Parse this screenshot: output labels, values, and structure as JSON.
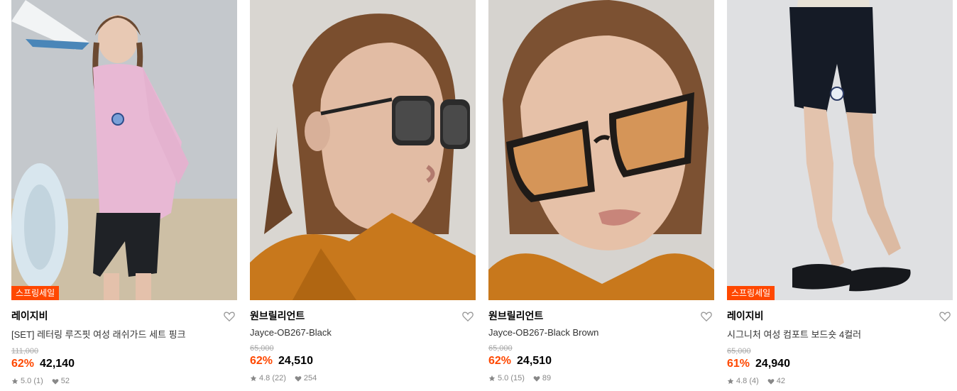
{
  "products": [
    {
      "badge": "스프링세일",
      "brand": "레이지비",
      "title": "[SET] 레터링 루즈핏 여성 래쉬가드 세트 핑크",
      "original_price": "111,000",
      "discount": "62%",
      "price": "42,140",
      "rating": "5.0 (1)",
      "likes": "52"
    },
    {
      "badge": "",
      "brand": "원브릴리언트",
      "title": "Jayce-OB267-Black",
      "original_price": "65,000",
      "discount": "62%",
      "price": "24,510",
      "rating": "4.8 (22)",
      "likes": "254"
    },
    {
      "badge": "",
      "brand": "원브릴리언트",
      "title": "Jayce-OB267-Black Brown",
      "original_price": "65,000",
      "discount": "62%",
      "price": "24,510",
      "rating": "5.0 (15)",
      "likes": "89"
    },
    {
      "badge": "스프링세일",
      "brand": "레이지비",
      "title": "시그니처 여성 컴포트 보드숏 4컬러",
      "original_price": "65,000",
      "discount": "61%",
      "price": "24,940",
      "rating": "4.8 (4)",
      "likes": "42"
    }
  ],
  "colors": {
    "accent": "#ff4800",
    "muted": "#888888"
  },
  "icons": {
    "like": "heart-outline-icon",
    "star": "star-icon",
    "heart_small": "heart-filled-icon"
  }
}
